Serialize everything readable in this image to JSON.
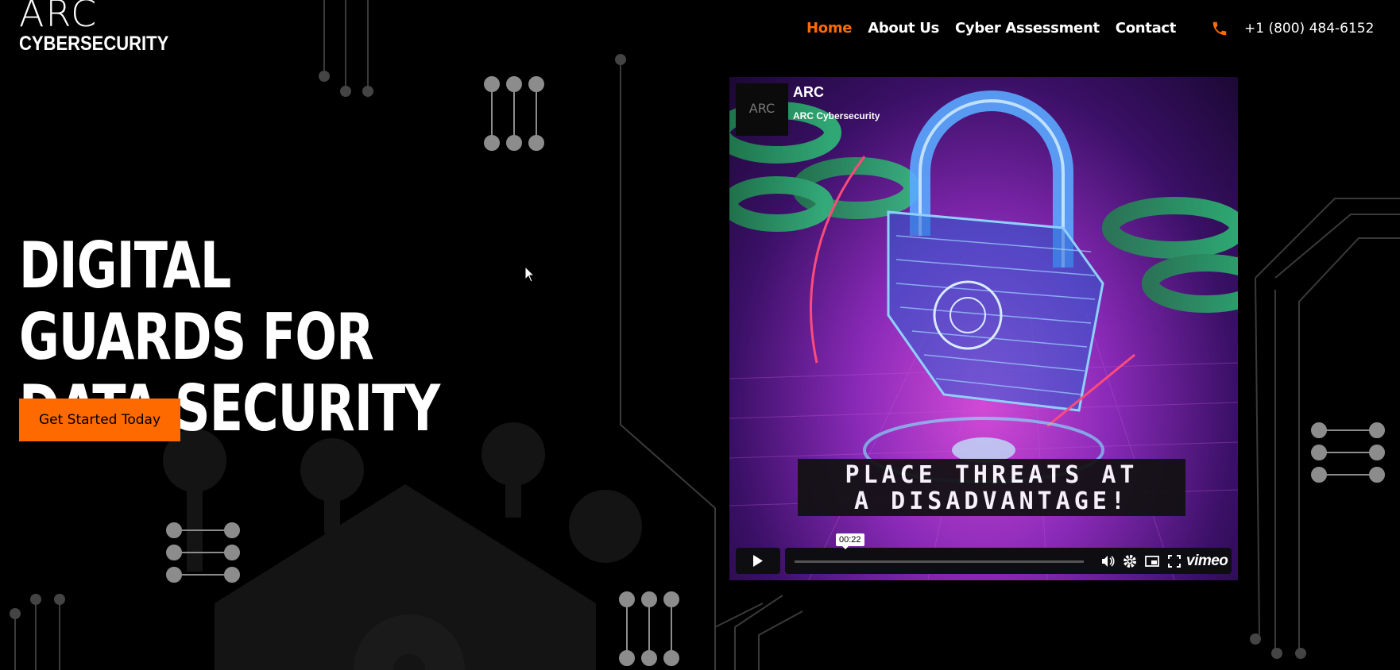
{
  "brand": {
    "logo_top": "ARC",
    "logo_bottom": "CYBERSECURITY"
  },
  "nav": {
    "items": [
      {
        "label": "Home",
        "active": true
      },
      {
        "label": "About Us",
        "active": false
      },
      {
        "label": "Cyber Assessment",
        "active": false
      },
      {
        "label": "Contact",
        "active": false
      }
    ]
  },
  "contact": {
    "phone": "+1 (800) 484-6152",
    "icon": "phone-icon"
  },
  "hero": {
    "title_line1": "DIGITAL GUARDS FOR",
    "title_line2": "DATA SECURITY",
    "cta_label": "Get Started Today"
  },
  "video": {
    "title": "ARC",
    "author": "ARC Cybersecurity",
    "caption_line1": "PLACE THREATS AT",
    "caption_line2": "A DISADVANTAGE!",
    "timestamp": "00:22",
    "provider": "vimeo",
    "progress": 0.0
  },
  "colors": {
    "accent": "#ff6a00",
    "background": "#000000",
    "circuit": "#8c8c8c"
  }
}
